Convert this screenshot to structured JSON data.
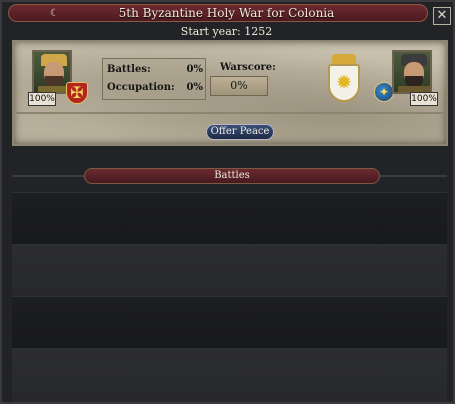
{
  "window": {
    "title": "5th Byzantine Holy War for Colonia",
    "start_year": "Start year: 1252",
    "close_glyph": "✕"
  },
  "attacker": {
    "strength": "100%"
  },
  "defender": {
    "strength": "100%"
  },
  "stats": {
    "battles_label": "Battles:",
    "battles_value": "0%",
    "occupation_label": "Occupation:",
    "occupation_value": "0%"
  },
  "warscore": {
    "label": "Warscore:",
    "value": "0%"
  },
  "actions": {
    "offer_peace_label": "Offer Peace"
  },
  "battles_section": {
    "header": "Battles",
    "row_count_visible": 4
  },
  "icons": {
    "moon": "moon-icon",
    "close": "close-icon",
    "attacker_shield": "cross-shield-icon",
    "defender_coa": "sun-coat-of-arms-icon",
    "defender_orb": "orb-icon"
  },
  "colors": {
    "title_bar": "#5a2026",
    "parchment": "#c2baa6",
    "offer_peace": "#2a3a5e"
  }
}
